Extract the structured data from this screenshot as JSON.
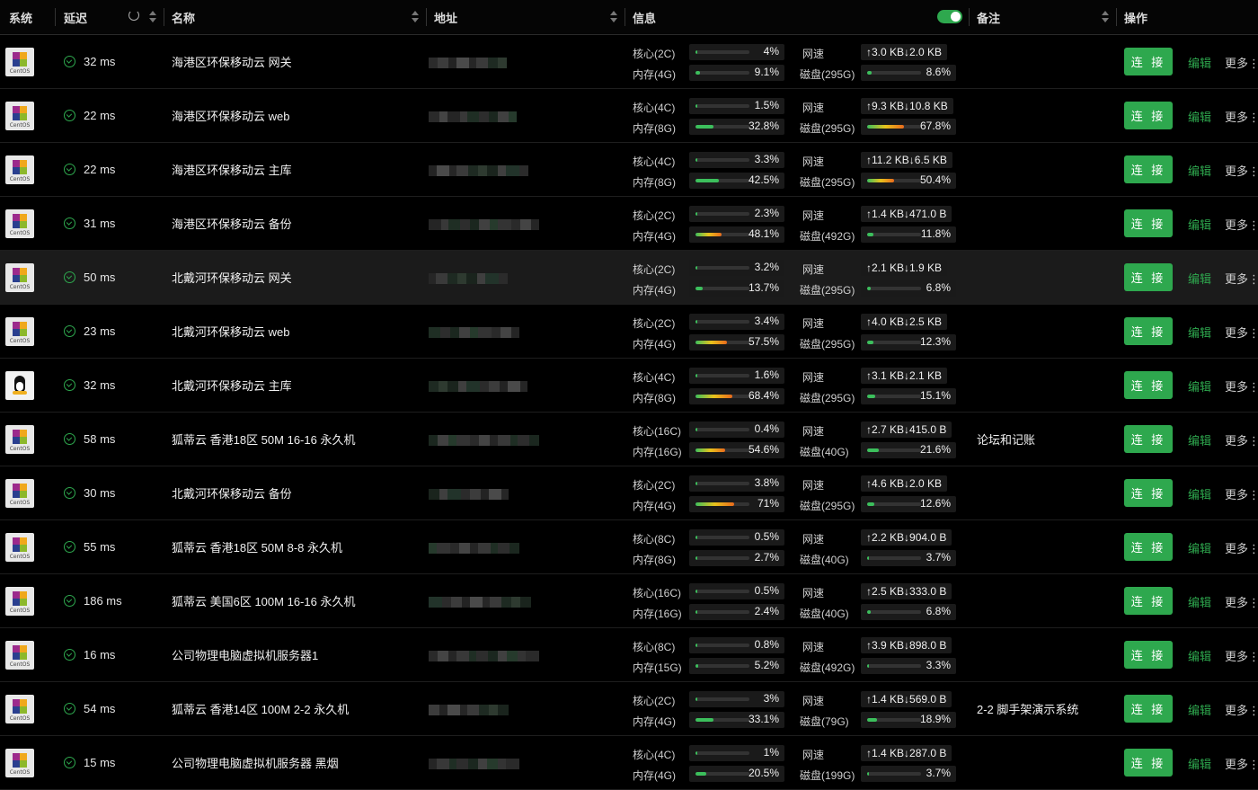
{
  "columns": {
    "system": "系统",
    "latency": "延迟",
    "name": "名称",
    "address": "地址",
    "info": "信息",
    "note": "备注",
    "actions": "操作"
  },
  "labels": {
    "net": "网速",
    "connect": "连 接",
    "edit": "编辑",
    "more": "更多",
    "more_dots": "⋮"
  },
  "rows": [
    {
      "os": "centos",
      "latency": "32 ms",
      "name": "海港区环保移动云 网关",
      "core": "核心(2C)",
      "cpu": "4%",
      "cpu_v": 0.04,
      "mem": "内存(4G)",
      "mem_pct": "9.1%",
      "mem_v": 0.091,
      "disk": "磁盘(295G)",
      "disk_pct": "8.6%",
      "disk_v": 0.086,
      "net": "↑3.0 KB↓2.0 KB",
      "note": ""
    },
    {
      "os": "centos",
      "latency": "22 ms",
      "name": "海港区环保移动云 web",
      "core": "核心(4C)",
      "cpu": "1.5%",
      "cpu_v": 0.015,
      "mem": "内存(8G)",
      "mem_pct": "32.8%",
      "mem_v": 0.328,
      "disk": "磁盘(295G)",
      "disk_pct": "67.8%",
      "disk_v": 0.678,
      "net": "↑9.3 KB↓10.8 KB",
      "note": ""
    },
    {
      "os": "centos",
      "latency": "22 ms",
      "name": "海港区环保移动云 主库",
      "core": "核心(4C)",
      "cpu": "3.3%",
      "cpu_v": 0.033,
      "mem": "内存(8G)",
      "mem_pct": "42.5%",
      "mem_v": 0.425,
      "disk": "磁盘(295G)",
      "disk_pct": "50.4%",
      "disk_v": 0.504,
      "net": "↑11.2 KB↓6.5 KB",
      "note": ""
    },
    {
      "os": "centos",
      "latency": "31 ms",
      "name": "海港区环保移动云 备份",
      "core": "核心(2C)",
      "cpu": "2.3%",
      "cpu_v": 0.023,
      "mem": "内存(4G)",
      "mem_pct": "48.1%",
      "mem_v": 0.481,
      "disk": "磁盘(492G)",
      "disk_pct": "11.8%",
      "disk_v": 0.118,
      "net": "↑1.4 KB↓471.0 B",
      "note": ""
    },
    {
      "os": "centos",
      "latency": "50 ms",
      "name": "北戴河环保移动云 网关",
      "core": "核心(2C)",
      "cpu": "3.2%",
      "cpu_v": 0.032,
      "mem": "内存(4G)",
      "mem_pct": "13.7%",
      "mem_v": 0.137,
      "disk": "磁盘(295G)",
      "disk_pct": "6.8%",
      "disk_v": 0.068,
      "net": "↑2.1 KB↓1.9 KB",
      "note": "",
      "highlight": true
    },
    {
      "os": "centos",
      "latency": "23 ms",
      "name": "北戴河环保移动云 web",
      "core": "核心(2C)",
      "cpu": "3.4%",
      "cpu_v": 0.034,
      "mem": "内存(4G)",
      "mem_pct": "57.5%",
      "mem_v": 0.575,
      "disk": "磁盘(295G)",
      "disk_pct": "12.3%",
      "disk_v": 0.123,
      "net": "↑4.0 KB↓2.5 KB",
      "note": ""
    },
    {
      "os": "linux",
      "latency": "32 ms",
      "name": "北戴河环保移动云 主库",
      "core": "核心(4C)",
      "cpu": "1.6%",
      "cpu_v": 0.016,
      "mem": "内存(8G)",
      "mem_pct": "68.4%",
      "mem_v": 0.684,
      "disk": "磁盘(295G)",
      "disk_pct": "15.1%",
      "disk_v": 0.151,
      "net": "↑3.1 KB↓2.1 KB",
      "note": ""
    },
    {
      "os": "centos",
      "latency": "58 ms",
      "name": "狐蒂云 香港18区 50M 16-16 永久机",
      "core": "核心(16C)",
      "cpu": "0.4%",
      "cpu_v": 0.004,
      "mem": "内存(16G)",
      "mem_pct": "54.6%",
      "mem_v": 0.546,
      "disk": "磁盘(40G)",
      "disk_pct": "21.6%",
      "disk_v": 0.216,
      "net": "↑2.7 KB↓415.0 B",
      "note": "论坛和记账"
    },
    {
      "os": "centos",
      "latency": "30 ms",
      "name": "北戴河环保移动云 备份",
      "core": "核心(2C)",
      "cpu": "3.8%",
      "cpu_v": 0.038,
      "mem": "内存(4G)",
      "mem_pct": "71%",
      "mem_v": 0.71,
      "disk": "磁盘(295G)",
      "disk_pct": "12.6%",
      "disk_v": 0.126,
      "net": "↑4.6 KB↓2.0 KB",
      "note": ""
    },
    {
      "os": "centos",
      "latency": "55 ms",
      "name": "狐蒂云 香港18区 50M 8-8 永久机",
      "core": "核心(8C)",
      "cpu": "0.5%",
      "cpu_v": 0.005,
      "mem": "内存(8G)",
      "mem_pct": "2.7%",
      "mem_v": 0.027,
      "disk": "磁盘(40G)",
      "disk_pct": "3.7%",
      "disk_v": 0.037,
      "net": "↑2.2 KB↓904.0 B",
      "note": ""
    },
    {
      "os": "centos",
      "latency": "186 ms",
      "name": "狐蒂云 美国6区 100M 16-16 永久机",
      "core": "核心(16C)",
      "cpu": "0.5%",
      "cpu_v": 0.005,
      "mem": "内存(16G)",
      "mem_pct": "2.4%",
      "mem_v": 0.024,
      "disk": "磁盘(40G)",
      "disk_pct": "6.8%",
      "disk_v": 0.068,
      "net": "↑2.5 KB↓333.0 B",
      "note": ""
    },
    {
      "os": "centos",
      "latency": "16 ms",
      "name": "公司物理电脑虚拟机服务器1",
      "core": "核心(8C)",
      "cpu": "0.8%",
      "cpu_v": 0.008,
      "mem": "内存(15G)",
      "mem_pct": "5.2%",
      "mem_v": 0.052,
      "disk": "磁盘(492G)",
      "disk_pct": "3.3%",
      "disk_v": 0.033,
      "net": "↑3.9 KB↓898.0 B",
      "note": ""
    },
    {
      "os": "centos",
      "latency": "54 ms",
      "name": "狐蒂云 香港14区 100M 2-2 永久机",
      "core": "核心(2C)",
      "cpu": "3%",
      "cpu_v": 0.03,
      "mem": "内存(4G)",
      "mem_pct": "33.1%",
      "mem_v": 0.331,
      "disk": "磁盘(79G)",
      "disk_pct": "18.9%",
      "disk_v": 0.189,
      "net": "↑1.4 KB↓569.0 B",
      "note": "2-2 脚手架演示系统"
    },
    {
      "os": "centos",
      "latency": "15 ms",
      "name": "公司物理电脑虚拟机服务器 黑烟",
      "core": "核心(4C)",
      "cpu": "1%",
      "cpu_v": 0.01,
      "mem": "内存(4G)",
      "mem_pct": "20.5%",
      "mem_v": 0.205,
      "disk": "磁盘(199G)",
      "disk_pct": "3.7%",
      "disk_v": 0.037,
      "net": "↑1.4 KB↓287.0 B",
      "note": ""
    }
  ]
}
